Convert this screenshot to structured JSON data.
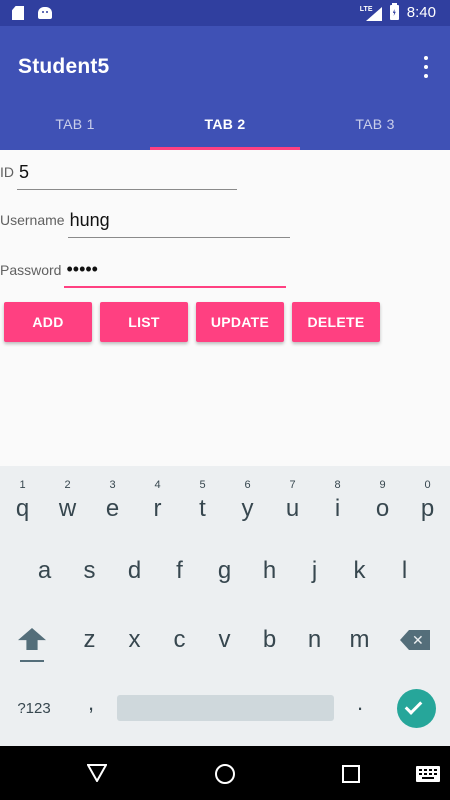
{
  "status_bar": {
    "network_label": "LTE",
    "time": "8:40",
    "icons": [
      "sd-card-icon",
      "android-icon",
      "signal-icon",
      "battery-charging-icon"
    ]
  },
  "app": {
    "title": "Student5",
    "overflow_icon": "more-vert-icon",
    "colors": {
      "primary": "#3f51b5",
      "primary_dark": "#303f9f",
      "accent": "#ff4081"
    }
  },
  "tabs": [
    {
      "label": "TAB 1",
      "active": false
    },
    {
      "label": "TAB 2",
      "active": true
    },
    {
      "label": "TAB 3",
      "active": false
    }
  ],
  "form": {
    "id": {
      "label": "ID",
      "value": "5"
    },
    "username": {
      "label": "Username",
      "value": "hung"
    },
    "password": {
      "label": "Password",
      "value": "•••••"
    }
  },
  "buttons": {
    "add": "ADD",
    "list": "LIST",
    "update": "UPDATE",
    "delete": "DELETE"
  },
  "keyboard": {
    "row1": [
      {
        "char": "q",
        "hint": "1"
      },
      {
        "char": "w",
        "hint": "2"
      },
      {
        "char": "e",
        "hint": "3"
      },
      {
        "char": "r",
        "hint": "4"
      },
      {
        "char": "t",
        "hint": "5"
      },
      {
        "char": "y",
        "hint": "6"
      },
      {
        "char": "u",
        "hint": "7"
      },
      {
        "char": "i",
        "hint": "8"
      },
      {
        "char": "o",
        "hint": "9"
      },
      {
        "char": "p",
        "hint": "0"
      }
    ],
    "row2": [
      "a",
      "s",
      "d",
      "f",
      "g",
      "h",
      "j",
      "k",
      "l"
    ],
    "row3": [
      "z",
      "x",
      "c",
      "v",
      "b",
      "n",
      "m"
    ],
    "symbols_label": "?123",
    "comma": ",",
    "period": ".",
    "accent_color": "#26a69a"
  },
  "nav_bar": {
    "icons": [
      "back-icon",
      "home-icon",
      "recents-icon",
      "keyboard-switch-icon"
    ]
  }
}
